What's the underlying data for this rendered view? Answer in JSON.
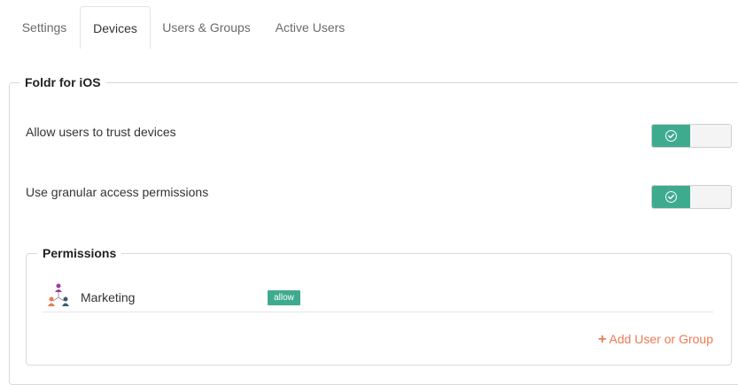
{
  "tabs": [
    {
      "label": "Settings",
      "active": false
    },
    {
      "label": "Devices",
      "active": true
    },
    {
      "label": "Users & Groups",
      "active": false
    },
    {
      "label": "Active Users",
      "active": false
    }
  ],
  "section": {
    "title": "Foldr for iOS",
    "settings": [
      {
        "label": "Allow users to trust devices",
        "enabled": true
      },
      {
        "label": "Use granular access permissions",
        "enabled": true
      }
    ]
  },
  "permissions": {
    "title": "Permissions",
    "entries": [
      {
        "name": "Marketing",
        "access": "allow",
        "icon": "group-icon"
      }
    ],
    "add_label": "Add User or Group",
    "add_icon": "plus-icon"
  },
  "colors": {
    "accent": "#3fab8e",
    "link": "#ea7a55"
  }
}
